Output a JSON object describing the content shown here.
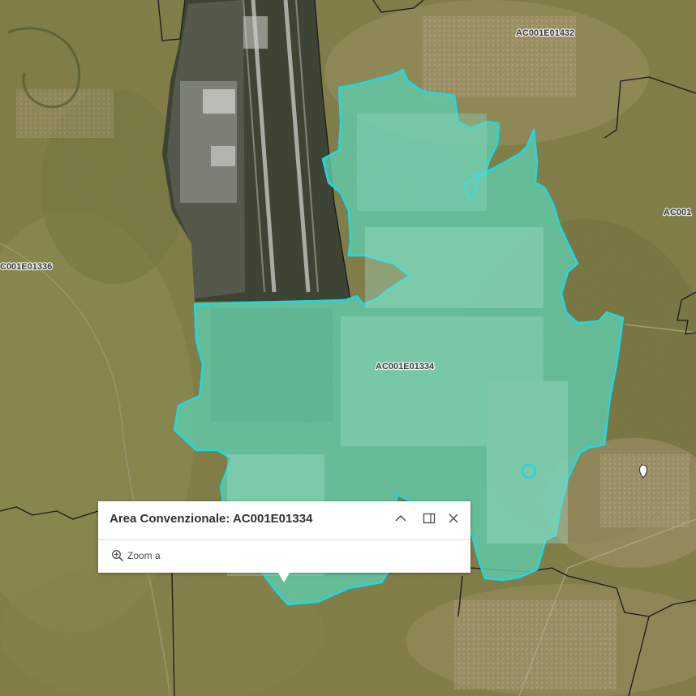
{
  "map": {
    "labels": [
      {
        "id": "ac001e01432",
        "text": "AC001E01432"
      },
      {
        "id": "ac001e01336",
        "text": "C001E01336"
      },
      {
        "id": "ac001e01334",
        "text": "AC001E01334"
      },
      {
        "id": "ac001e01-right",
        "text": "AC001"
      }
    ],
    "colors": {
      "highlight_fill": "#5fcba8",
      "highlight_stroke": "#21d8e0",
      "boundary": "#1a1a1a",
      "basemap": "#7d7a45"
    }
  },
  "popup": {
    "title": "Area Convenzionale: AC001E01334",
    "collapse_icon": "chevron-up-icon",
    "dock_icon": "dock-icon",
    "close_icon": "close-icon",
    "zoom_icon": "zoom-in-icon",
    "zoom_label": "Zoom a"
  }
}
